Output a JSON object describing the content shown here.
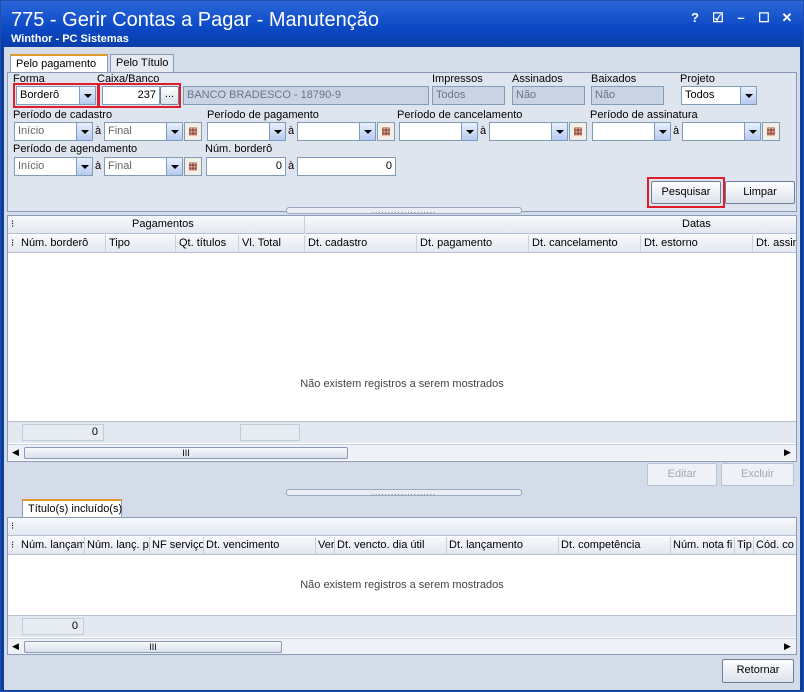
{
  "window": {
    "title": "775 - Gerir Contas a Pagar - Manutenção",
    "subtitle": "Winthor - PC Sistemas",
    "help": "?",
    "restore": "☑",
    "minimize": "–",
    "maximize": "☐",
    "close": "✕"
  },
  "tabs": [
    "Pelo pagamento",
    "Pelo Título"
  ],
  "filters": {
    "forma_label": "Forma",
    "forma_value": "Borderô",
    "caixa_label": "Caixa/Banco",
    "caixa_value": "237",
    "caixa_button": "...",
    "caixa_desc": "BANCO BRADESCO - 18790-9",
    "impressos_label": "Impressos",
    "impressos_value": "Todos",
    "assinados_label": "Assinados",
    "assinados_value": "Não",
    "baixados_label": "Baixados",
    "baixados_value": "Não",
    "projeto_label": "Projeto",
    "projeto_value": "Todos",
    "periodo_cadastro_label": "Período de cadastro",
    "cadastro_inicio": "Início",
    "cadastro_final": "Final",
    "periodo_pagamento_label": "Período de pagamento",
    "periodo_cancelamento_label": "Período de cancelamento",
    "periodo_assinatura_label": "Período de assinatura",
    "periodo_agendamento_label": "Período de agendamento",
    "agendamento_inicio": "Início",
    "agendamento_final": "Final",
    "num_bordero_label": "Núm. borderô",
    "num_bordero_de": "0",
    "num_bordero_ate": "0",
    "a": "à"
  },
  "actions": {
    "pesquisar": "Pesquisar",
    "limpar": "Limpar",
    "editar": "Editar",
    "excluir": "Excluir",
    "retornar": "Retornar"
  },
  "grid1": {
    "group_pagamentos": "Pagamentos",
    "group_datas": "Datas",
    "columns": [
      "Núm. borderô",
      "Tipo",
      "Qt. títulos",
      "Vl. Total",
      "Dt. cadastro",
      "Dt. pagamento",
      "Dt. cancelamento",
      "Dt. estorno",
      "Dt. assina"
    ],
    "empty": "Não existem registros a serem mostrados",
    "footer_count": "0"
  },
  "tab2": "Título(s) incluído(s)",
  "grid2": {
    "columns": [
      "Núm. lançam",
      "Núm. lanç. p",
      "NF serviço",
      "Dt. vencimento",
      "Ver",
      "Dt. vencto. dia útil",
      "Dt. lançamento",
      "Dt. competência",
      "Núm. nota fi",
      "Tip",
      "Cód. co"
    ],
    "empty": "Não existem registros a serem mostrados",
    "footer_count": "0"
  },
  "scroll_mark": "III",
  "splitter_marks": "....................",
  "colors": {
    "titlebar": "#0b48c4",
    "highlight": "#e01e2a",
    "tab_accent": "#e09a2a"
  }
}
